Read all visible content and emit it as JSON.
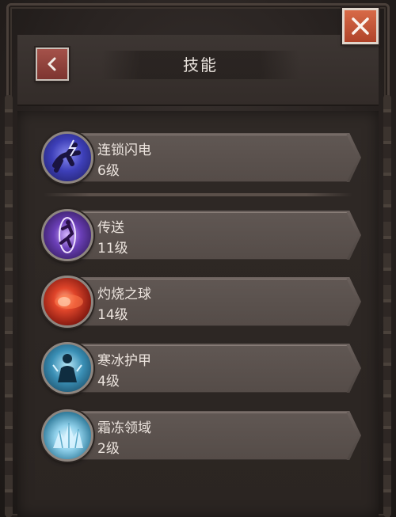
{
  "header": {
    "title": "技能",
    "back_icon": "chevron-left-icon",
    "close_icon": "close-icon"
  },
  "skills": [
    {
      "name": "连锁闪电",
      "level": "6级",
      "icon": "chain-lightning-icon",
      "color": "#3d3fb8"
    },
    {
      "name": "传送",
      "level": "11级",
      "icon": "teleport-icon",
      "color": "#6b3fb8"
    },
    {
      "name": "灼烧之球",
      "level": "14级",
      "icon": "fireball-icon",
      "color": "#c0392b"
    },
    {
      "name": "寒冰护甲",
      "level": "4级",
      "icon": "frost-armor-icon",
      "color": "#3a8fb5"
    },
    {
      "name": "霜冻领域",
      "level": "2级",
      "icon": "frost-field-icon",
      "color": "#5fb1cf"
    }
  ],
  "colors": {
    "close_button": "#c5543a",
    "back_button": "#8f433c",
    "panel": "#2f2926"
  }
}
